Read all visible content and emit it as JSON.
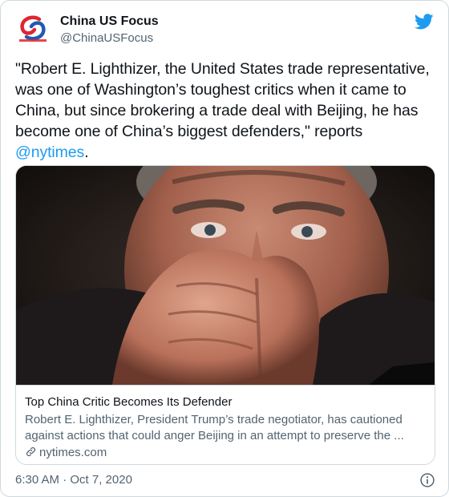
{
  "account": {
    "display_name": "China US Focus",
    "handle": "@ChinaUSFocus",
    "avatar_caption": "CHINA-US Focus"
  },
  "tweet": {
    "text_before": "\"Robert E. Lighthizer, the United States trade representative, was one of Washington’s toughest critics when it came to China, but since brokering a trade deal with Beijing, he has become one of China’s biggest defenders,\" reports ",
    "mention": "@nytimes",
    "text_after": "."
  },
  "link_card": {
    "title": "Top China Critic Becomes Its Defender",
    "description": "Robert E. Lighthizer, President Trump’s trade negotiator, has cautioned against actions that could anger Beijing in an attempt to preserve the ...",
    "domain": "nytimes.com"
  },
  "footer": {
    "timestamp": "6:30 AM · Oct 7, 2020"
  },
  "colors": {
    "accent": "#1d9bf0",
    "text": "#0f1419",
    "muted": "#536471",
    "border": "#cfd9de"
  },
  "icons": [
    "china-us-focus-logo",
    "twitter-bird-icon",
    "link-icon",
    "info-icon"
  ]
}
